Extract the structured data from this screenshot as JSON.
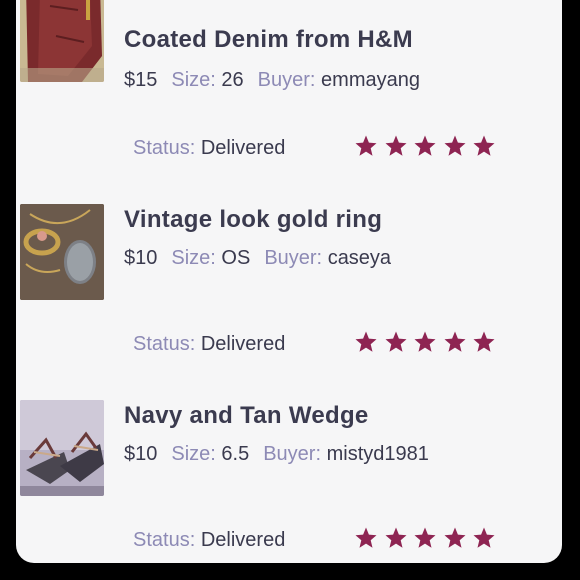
{
  "items": [
    {
      "title": "Coated Denim from H&M",
      "price": "$15",
      "size_label": "Size:",
      "size": "26",
      "buyer_label": "Buyer:",
      "buyer": "emmayang",
      "status_label": "Status:",
      "status": "Delivered",
      "rating": 5,
      "thumb": "red-pants-photo"
    },
    {
      "title": "Vintage look gold ring",
      "price": "$10",
      "size_label": "Size:",
      "size": "OS",
      "buyer_label": "Buyer:",
      "buyer": "caseya",
      "status_label": "Status:",
      "status": "Delivered",
      "rating": 5,
      "thumb": "gold-ring-photo"
    },
    {
      "title": "Navy and Tan Wedge",
      "price": "$10",
      "size_label": "Size:",
      "size": "6.5",
      "buyer_label": "Buyer:",
      "buyer": "mistyd1981",
      "status_label": "Status:",
      "status": "Delivered",
      "rating": 5,
      "thumb": "wedge-shoes-photo"
    }
  ],
  "colors": {
    "star": "#8e2452",
    "label": "#8d8ab5",
    "text": "#3a3a4e",
    "background": "#f6f6f7"
  }
}
